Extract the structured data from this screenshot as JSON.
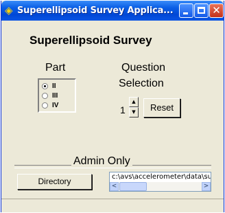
{
  "window": {
    "title": "Superellipsoid Survey Applica...",
    "icon": "diamond-app-icon",
    "close_glyph": "✕"
  },
  "app": {
    "heading": "Superellipsoid Survey"
  },
  "part": {
    "label": "Part",
    "options": [
      "II",
      "III",
      "IV"
    ],
    "selected": "II"
  },
  "question": {
    "label_line1": "Question",
    "label_line2": "Selection",
    "value": "1",
    "spin_up": "▲",
    "spin_down": "▼",
    "reset_label": "Reset"
  },
  "admin": {
    "label": "Admin Only",
    "directory_label": "Directory",
    "path_value": "c:\\avs\\accelerometer\\data\\su",
    "scroll_left": "<",
    "scroll_right": ">"
  }
}
